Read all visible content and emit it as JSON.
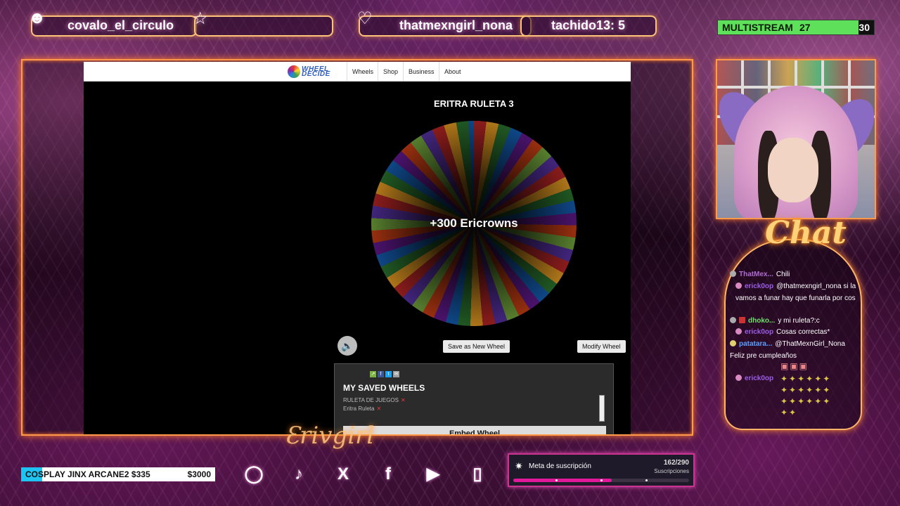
{
  "top_bar": {
    "recent_follower": "covalo_el_circulo",
    "recent_sub": "thatmexngirl_nona",
    "top_gift": "tachido13: 5",
    "multistream_label": "MULTISTREAM",
    "multistream_count": "27",
    "multistream_goal": "30"
  },
  "browser": {
    "nav": {
      "logo_text": "WHEEL DECIDE",
      "items": [
        "Wheels",
        "Shop",
        "Business",
        "About"
      ]
    },
    "wheel_title": "ERITRA RULETA 3",
    "wheel_result": "+300 Ericrowns",
    "save_button": "Save as New Wheel",
    "modify_button": "Modify Wheel",
    "saved_title": "MY SAVED WHEELS",
    "saved_items": [
      "RULETA DE JUEGOS",
      "Eritra Ruleta"
    ],
    "embed_button": "Embed Wheel"
  },
  "chat": {
    "title": "Chat",
    "messages": [
      {
        "user": "ThatMex...",
        "text": "Chili",
        "color": "#b06bd0"
      },
      {
        "user": "erick0op",
        "text": "@thatmexngirl_nona si la vamos a funar hay que funarla por cos",
        "color": "#9b5de5"
      },
      {
        "user": "dhoko...",
        "text": "y mi ruleta?:c",
        "color": "#6ee06a"
      },
      {
        "user": "erick0op",
        "text": "Cosas correctas*",
        "color": "#9b5de5"
      },
      {
        "user": "patatara...",
        "text": "@ThatMexnGirl_Nona Feliz pre cumpleaños",
        "color": "#5aa0ff"
      },
      {
        "user": "erick0op",
        "text": "",
        "color": "#9b5de5"
      }
    ]
  },
  "bottom_bar": {
    "goal_label": "COSPLAY JINX ARCANE2 $335",
    "goal_target": "$3000",
    "goal_progress": 0.11,
    "socials": [
      "instagram-icon",
      "tiktok-icon",
      "x-icon",
      "facebook-icon",
      "youtube-icon",
      "twitch-icon"
    ],
    "sub_goal_title": "Meta de suscripción",
    "sub_goal_count": "162/290",
    "sub_goal_unit": "Suscripciones",
    "sub_goal_progress": 0.56
  },
  "colors": {
    "accent_orange": "#ff9a4a",
    "accent_pink": "#e0189a",
    "multistream_green": "#5fe05a",
    "goal_blue": "#1ec3f2"
  }
}
